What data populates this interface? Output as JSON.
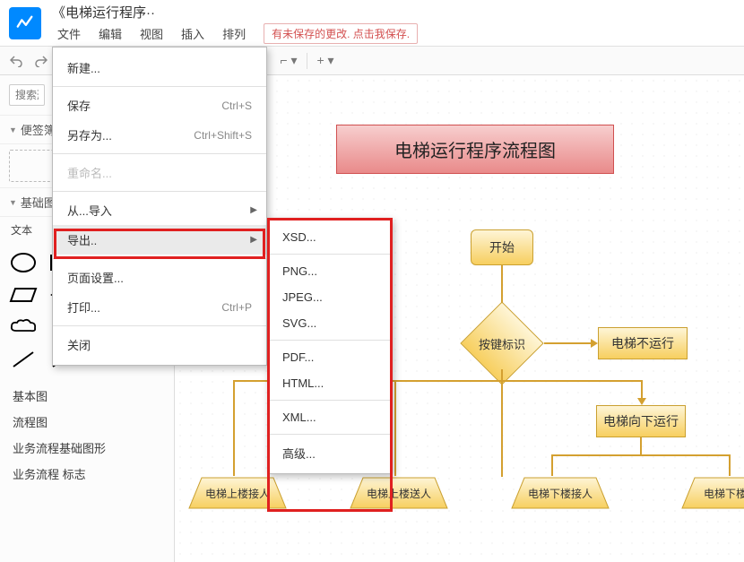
{
  "doc_title": "《电梯运行程序··",
  "menubar": [
    "文件",
    "编辑",
    "视图",
    "插入",
    "排列"
  ],
  "save_notice": "有未保存的更改. 点击我保存.",
  "sidebar": {
    "search_placeholder": "搜索形状",
    "section_scratch": "便签簿",
    "section_basic": "基础图形",
    "text_label": "文本",
    "categories": [
      "基本图",
      "流程图",
      "业务流程基础图形",
      "业务流程 标志"
    ]
  },
  "file_menu": {
    "new": "新建...",
    "save": "保存",
    "save_shortcut": "Ctrl+S",
    "saveas": "另存为...",
    "saveas_shortcut": "Ctrl+Shift+S",
    "rename": "重命名...",
    "import": "从...导入",
    "export": "导出..",
    "pagesetup": "页面设置...",
    "print": "打印...",
    "print_shortcut": "Ctrl+P",
    "close": "关闭"
  },
  "export_menu": {
    "xsd": "XSD...",
    "png": "PNG...",
    "jpeg": "JPEG...",
    "svg": "SVG...",
    "pdf": "PDF...",
    "html": "HTML...",
    "xml": "XML...",
    "advanced": "高级..."
  },
  "flowchart": {
    "title": "电梯运行程序流程图",
    "start": "开始",
    "keypress": "按键标识",
    "no_run": "电梯不运行",
    "down": "电梯向下运行",
    "node1": "电梯上楼接人",
    "node2": "电梯上楼送人",
    "node3": "电梯下楼接人",
    "node4": "电梯下楼送"
  }
}
